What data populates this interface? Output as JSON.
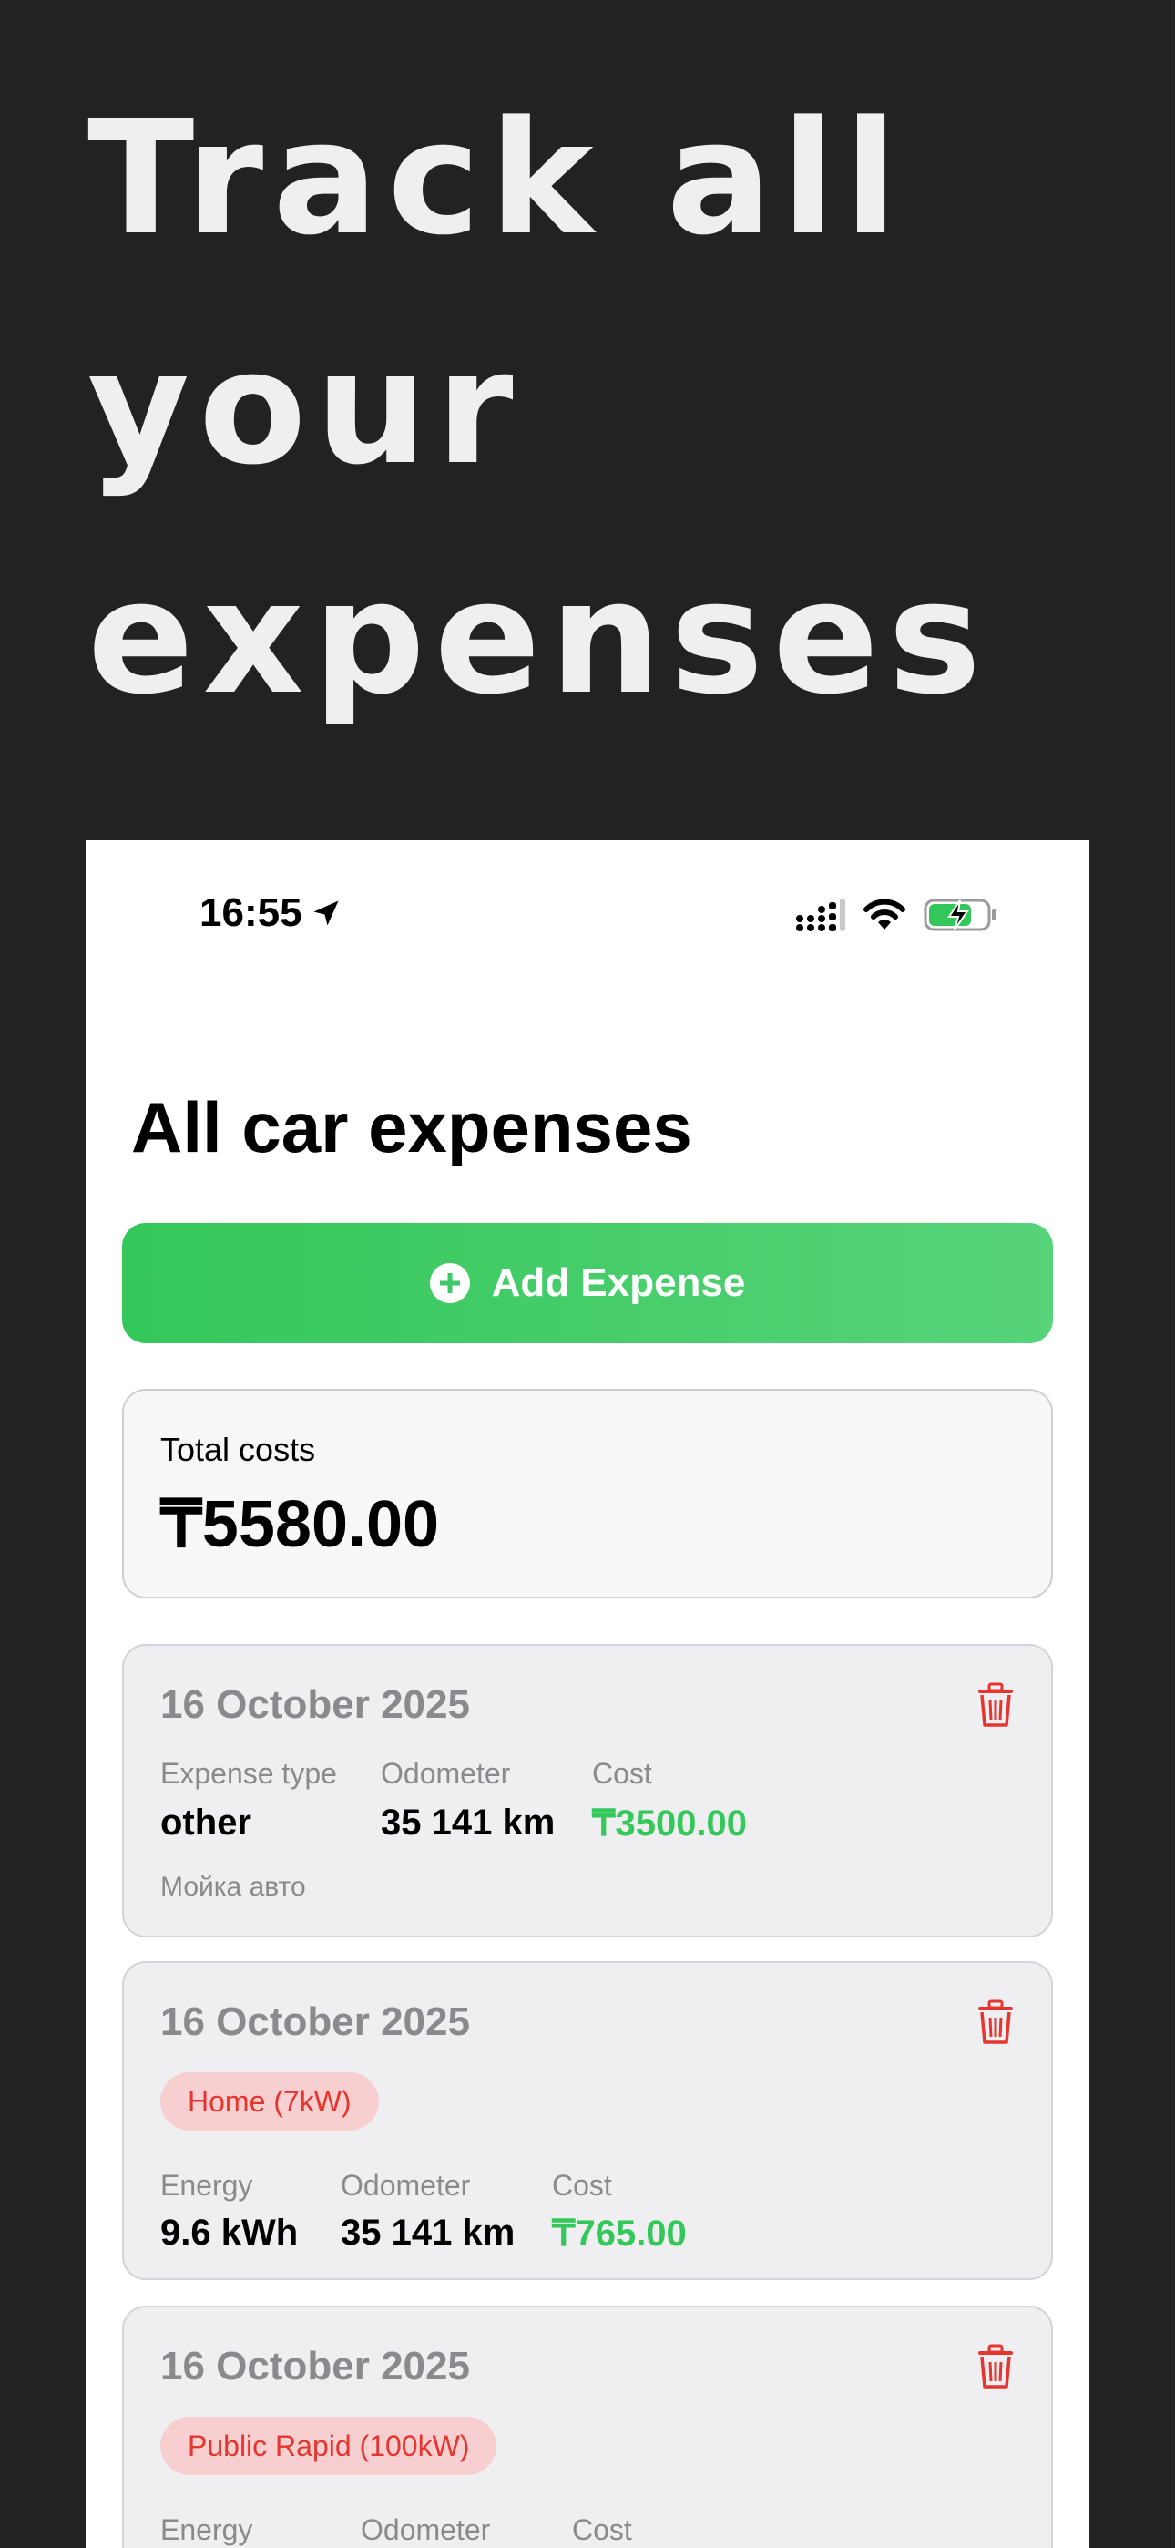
{
  "headline": "Track all\nyour\nexpenses",
  "status_bar": {
    "time": "16:55"
  },
  "page_title": "All car expenses",
  "add_button": {
    "label": "Add Expense"
  },
  "total": {
    "label": "Total costs",
    "value": "₸5580.00"
  },
  "expenses": [
    {
      "date": "16 October 2025",
      "fields": [
        {
          "label": "Expense type",
          "value": "other"
        },
        {
          "label": "Odometer",
          "value": "35 141 km"
        },
        {
          "label": "Cost",
          "value": "₸3500.00"
        }
      ],
      "note": "Мойка авто"
    },
    {
      "date": "16 October 2025",
      "chip": "Home (7kW)",
      "fields": [
        {
          "label": "Energy",
          "value": "9.6 kWh"
        },
        {
          "label": "Odometer",
          "value": "35 141 km"
        },
        {
          "label": "Cost",
          "value": "₸765.00"
        }
      ]
    },
    {
      "date": "16 October 2025",
      "chip": "Public Rapid (100kW)",
      "fields": [
        {
          "label": "Energy"
        },
        {
          "label": "Odometer"
        },
        {
          "label": "Cost"
        }
      ]
    }
  ],
  "colors": {
    "background": "#222222",
    "accent_green": "#34c759",
    "delete_red": "#e5352f",
    "chip_bg": "#f8cfd0",
    "card_bg": "#efeff1"
  },
  "icons": [
    "location-arrow-icon",
    "cellular-signal-icon",
    "wifi-icon",
    "battery-charging-icon",
    "plus-circle-icon",
    "trash-icon"
  ]
}
